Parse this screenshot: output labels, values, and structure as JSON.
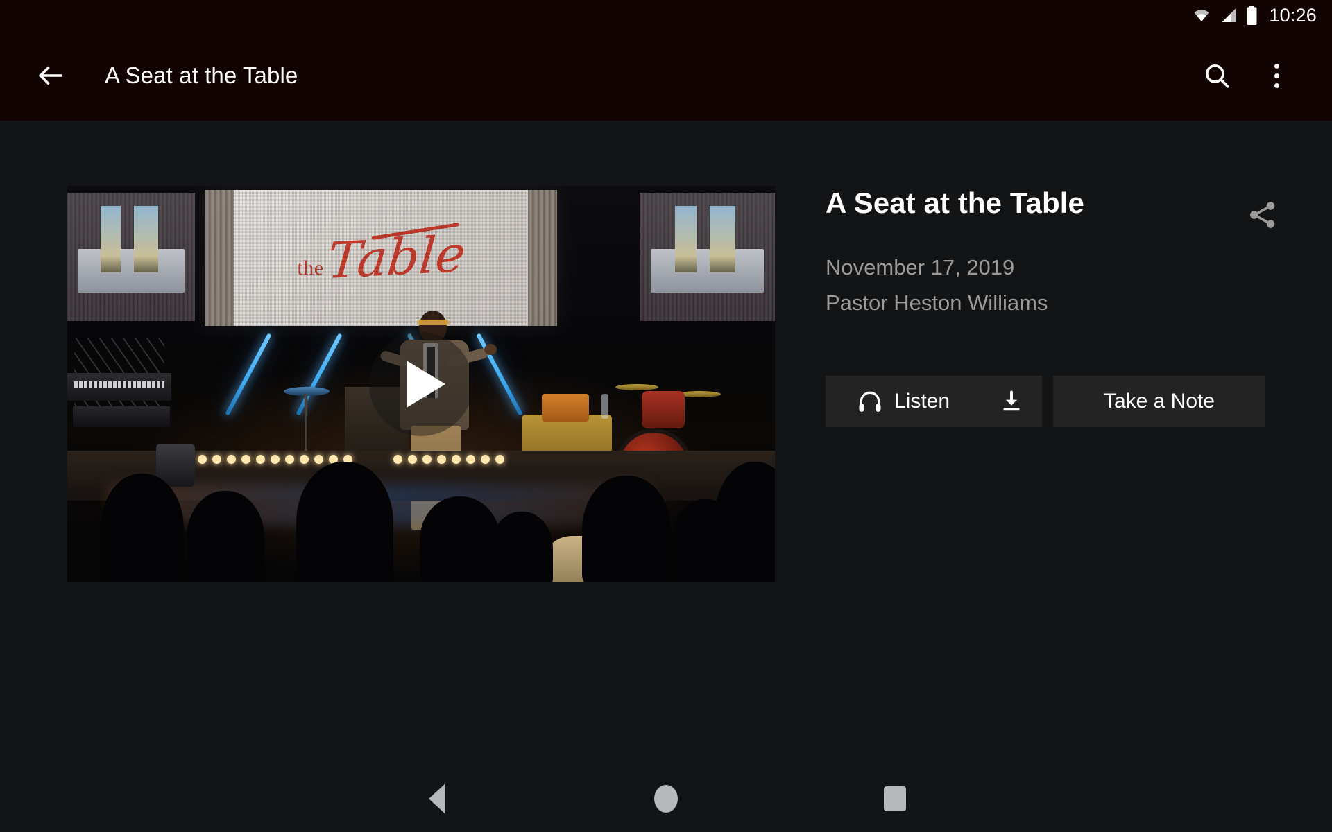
{
  "status_bar": {
    "time": "10:26",
    "icons": [
      "wifi-icon",
      "cellular-signal-icon",
      "battery-icon"
    ]
  },
  "app_bar": {
    "back_icon": "back-arrow-icon",
    "title": "A Seat at the Table",
    "search_icon": "search-icon",
    "overflow_icon": "overflow-menu-icon",
    "background_color": "#120403"
  },
  "video": {
    "play_icon": "play-icon",
    "stage_screen_text_the": "the",
    "stage_screen_text_table": "Table",
    "accent_color": "#bb3a2b"
  },
  "details": {
    "title": "A Seat at the Table",
    "date": "November 17, 2019",
    "speaker": "Pastor Heston Williams",
    "share_icon": "share-icon",
    "title_color": "#ffffff",
    "meta_color": "#9b9b9b"
  },
  "actions": {
    "listen_label": "Listen",
    "listen_icon": "headphones-icon",
    "download_icon": "download-icon",
    "note_label": "Take a Note",
    "button_color": "#232323"
  },
  "nav_bar": {
    "back_icon": "nav-back-icon",
    "home_icon": "nav-home-icon",
    "recents_icon": "nav-recents-icon"
  },
  "theme": {
    "background": "#121416"
  }
}
